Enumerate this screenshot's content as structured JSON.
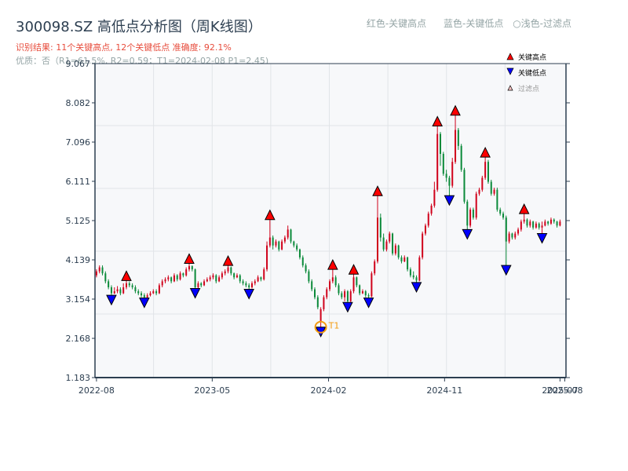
{
  "header": {
    "title": "300098.SZ 高低点分析图（周K线图）",
    "result": "识别结果: 11个关键高点, 12个关键低点  准确度: 92.1%",
    "quality": "优质：否（R1=61.5%, R2=0.59；T1=2024-02-08 P1=2.45)"
  },
  "top_legend": [
    "红色-关键高点",
    "蓝色-关键低点",
    "○浅色-过滤点"
  ],
  "colors": {
    "up": "#d0021b",
    "down": "#0b8a3a",
    "high_marker": "#ff0000",
    "low_marker": "#0000ff",
    "t1": "#f39c12",
    "axis": "#2c3e50",
    "grid": "#e1e4e8",
    "plot_bg": "#f7f8fa"
  },
  "chart_data": {
    "type": "candlestick",
    "ylim": [
      1.183,
      9.067
    ],
    "yticks": [
      "1.183",
      "2.168",
      "3.154",
      "4.139",
      "5.125",
      "6.111",
      "7.096",
      "8.082",
      "9.067"
    ],
    "xticks": [
      {
        "label": "2022-08",
        "index": 0
      },
      {
        "label": "2023-05",
        "index": 38.7
      },
      {
        "label": "2024-02",
        "index": 77.6
      },
      {
        "label": "2024-11",
        "index": 116.4
      },
      {
        "label": "2025-07",
        "index": 155
      },
      {
        "label": "2025-08",
        "index": 156.6
      }
    ],
    "grid": true,
    "legend": {
      "placement": "top-right",
      "entries": [
        "关键高点",
        "关键低点",
        "过滤点"
      ]
    },
    "candles_ohlc": [
      [
        3.75,
        3.9,
        3.7,
        3.85
      ],
      [
        3.85,
        4.0,
        3.8,
        3.95
      ],
      [
        3.95,
        4.0,
        3.75,
        3.8
      ],
      [
        3.8,
        3.85,
        3.55,
        3.6
      ],
      [
        3.6,
        3.65,
        3.4,
        3.45
      ],
      [
        3.45,
        3.5,
        3.25,
        3.3
      ],
      [
        3.3,
        3.45,
        3.28,
        3.35
      ],
      [
        3.35,
        3.48,
        3.3,
        3.4
      ],
      [
        3.4,
        3.45,
        3.25,
        3.3
      ],
      [
        3.3,
        3.55,
        3.28,
        3.45
      ],
      [
        3.45,
        3.62,
        3.4,
        3.55
      ],
      [
        3.55,
        3.6,
        3.45,
        3.5
      ],
      [
        3.5,
        3.55,
        3.4,
        3.45
      ],
      [
        3.45,
        3.5,
        3.3,
        3.35
      ],
      [
        3.35,
        3.4,
        3.25,
        3.3
      ],
      [
        3.3,
        3.35,
        3.2,
        3.25
      ],
      [
        3.25,
        3.3,
        3.18,
        3.2
      ],
      [
        3.2,
        3.3,
        3.18,
        3.25
      ],
      [
        3.25,
        3.35,
        3.22,
        3.3
      ],
      [
        3.3,
        3.4,
        3.28,
        3.35
      ],
      [
        3.35,
        3.4,
        3.25,
        3.3
      ],
      [
        3.3,
        3.55,
        3.28,
        3.5
      ],
      [
        3.5,
        3.65,
        3.45,
        3.6
      ],
      [
        3.6,
        3.7,
        3.55,
        3.65
      ],
      [
        3.65,
        3.75,
        3.6,
        3.7
      ],
      [
        3.7,
        3.72,
        3.55,
        3.6
      ],
      [
        3.6,
        3.8,
        3.58,
        3.75
      ],
      [
        3.75,
        3.78,
        3.6,
        3.65
      ],
      [
        3.65,
        3.85,
        3.62,
        3.8
      ],
      [
        3.8,
        3.82,
        3.7,
        3.75
      ],
      [
        3.75,
        3.95,
        3.72,
        3.9
      ],
      [
        3.9,
        4.05,
        3.85,
        3.98
      ],
      [
        3.98,
        4.0,
        3.85,
        3.9
      ],
      [
        3.9,
        3.92,
        3.42,
        3.45
      ],
      [
        3.45,
        3.6,
        3.42,
        3.55
      ],
      [
        3.55,
        3.58,
        3.45,
        3.5
      ],
      [
        3.5,
        3.65,
        3.48,
        3.6
      ],
      [
        3.6,
        3.7,
        3.58,
        3.65
      ],
      [
        3.65,
        3.75,
        3.6,
        3.7
      ],
      [
        3.7,
        3.8,
        3.65,
        3.75
      ],
      [
        3.75,
        3.78,
        3.55,
        3.6
      ],
      [
        3.6,
        3.75,
        3.58,
        3.7
      ],
      [
        3.7,
        3.85,
        3.65,
        3.8
      ],
      [
        3.8,
        3.9,
        3.75,
        3.85
      ],
      [
        3.85,
        4.0,
        3.8,
        3.95
      ],
      [
        3.95,
        3.97,
        3.75,
        3.8
      ],
      [
        3.8,
        3.82,
        3.65,
        3.7
      ],
      [
        3.7,
        3.8,
        3.68,
        3.75
      ],
      [
        3.75,
        3.78,
        3.55,
        3.6
      ],
      [
        3.6,
        3.65,
        3.5,
        3.55
      ],
      [
        3.55,
        3.6,
        3.45,
        3.5
      ],
      [
        3.5,
        3.55,
        3.4,
        3.45
      ],
      [
        3.45,
        3.6,
        3.42,
        3.55
      ],
      [
        3.55,
        3.65,
        3.5,
        3.6
      ],
      [
        3.6,
        3.75,
        3.58,
        3.7
      ],
      [
        3.7,
        3.72,
        3.6,
        3.65
      ],
      [
        3.65,
        3.95,
        3.62,
        3.9
      ],
      [
        3.9,
        4.6,
        3.85,
        4.5
      ],
      [
        4.5,
        5.15,
        4.45,
        4.7
      ],
      [
        4.7,
        4.75,
        4.4,
        4.5
      ],
      [
        4.5,
        4.65,
        4.45,
        4.6
      ],
      [
        4.6,
        4.62,
        4.35,
        4.4
      ],
      [
        4.4,
        4.65,
        4.38,
        4.6
      ],
      [
        4.6,
        4.75,
        4.55,
        4.7
      ],
      [
        4.7,
        5.0,
        4.65,
        4.9
      ],
      [
        4.9,
        4.92,
        4.55,
        4.6
      ],
      [
        4.6,
        4.62,
        4.45,
        4.5
      ],
      [
        4.5,
        4.55,
        4.35,
        4.4
      ],
      [
        4.4,
        4.42,
        4.15,
        4.2
      ],
      [
        4.2,
        4.25,
        3.95,
        4.0
      ],
      [
        4.0,
        4.05,
        3.8,
        3.85
      ],
      [
        3.85,
        3.9,
        3.55,
        3.6
      ],
      [
        3.6,
        3.65,
        3.35,
        3.4
      ],
      [
        3.4,
        3.45,
        3.15,
        3.2
      ],
      [
        3.2,
        3.25,
        2.9,
        2.95
      ],
      [
        2.6,
        2.95,
        2.45,
        2.9
      ],
      [
        2.9,
        3.25,
        2.85,
        3.2
      ],
      [
        3.2,
        3.45,
        3.15,
        3.4
      ],
      [
        3.4,
        3.65,
        3.35,
        3.6
      ],
      [
        3.6,
        3.9,
        3.55,
        3.7
      ],
      [
        3.7,
        3.75,
        3.45,
        3.5
      ],
      [
        3.5,
        3.55,
        3.25,
        3.3
      ],
      [
        3.3,
        3.35,
        3.15,
        3.2
      ],
      [
        3.2,
        3.4,
        3.1,
        3.35
      ],
      [
        3.35,
        3.38,
        3.07,
        3.1
      ],
      [
        3.1,
        3.4,
        3.08,
        3.35
      ],
      [
        3.35,
        3.78,
        3.3,
        3.7
      ],
      [
        3.7,
        3.72,
        3.45,
        3.5
      ],
      [
        3.5,
        3.52,
        3.25,
        3.3
      ],
      [
        3.3,
        3.4,
        3.28,
        3.35
      ],
      [
        3.35,
        3.38,
        3.2,
        3.25
      ],
      [
        3.25,
        3.3,
        3.18,
        3.22
      ],
      [
        3.22,
        3.85,
        3.2,
        3.8
      ],
      [
        3.8,
        4.15,
        3.75,
        4.1
      ],
      [
        4.1,
        5.75,
        4.05,
        5.2
      ],
      [
        5.2,
        5.3,
        4.6,
        4.7
      ],
      [
        4.7,
        4.8,
        4.35,
        4.4
      ],
      [
        4.4,
        4.65,
        4.35,
        4.6
      ],
      [
        4.6,
        4.85,
        4.55,
        4.8
      ],
      [
        4.8,
        4.82,
        4.25,
        4.3
      ],
      [
        4.3,
        4.55,
        4.25,
        4.5
      ],
      [
        4.5,
        4.52,
        4.15,
        4.2
      ],
      [
        4.2,
        4.25,
        4.05,
        4.1
      ],
      [
        4.1,
        4.25,
        4.08,
        4.2
      ],
      [
        4.2,
        4.22,
        3.85,
        3.9
      ],
      [
        3.9,
        3.95,
        3.7,
        3.75
      ],
      [
        3.75,
        3.85,
        3.65,
        3.7
      ],
      [
        3.7,
        3.75,
        3.57,
        3.62
      ],
      [
        3.62,
        4.25,
        3.6,
        4.2
      ],
      [
        4.2,
        4.85,
        4.15,
        4.8
      ],
      [
        4.8,
        5.05,
        4.75,
        5.0
      ],
      [
        5.0,
        5.35,
        4.95,
        5.3
      ],
      [
        5.3,
        5.55,
        5.25,
        5.5
      ],
      [
        5.5,
        6.1,
        5.45,
        5.9
      ],
      [
        5.9,
        7.5,
        5.85,
        7.3
      ],
      [
        7.3,
        7.35,
        6.5,
        6.8
      ],
      [
        6.8,
        6.85,
        6.25,
        6.3
      ],
      [
        6.3,
        6.4,
        6.1,
        6.2
      ],
      [
        6.2,
        6.25,
        5.75,
        6.0
      ],
      [
        6.0,
        6.7,
        5.95,
        6.6
      ],
      [
        6.6,
        7.77,
        6.55,
        7.4
      ],
      [
        7.4,
        7.45,
        6.9,
        7.0
      ],
      [
        7.0,
        7.05,
        6.35,
        6.4
      ],
      [
        6.4,
        6.45,
        5.55,
        5.6
      ],
      [
        5.6,
        5.65,
        4.9,
        5.0
      ],
      [
        5.0,
        5.45,
        4.95,
        5.4
      ],
      [
        5.4,
        5.45,
        5.15,
        5.2
      ],
      [
        5.2,
        5.85,
        5.15,
        5.8
      ],
      [
        5.8,
        5.95,
        5.75,
        5.9
      ],
      [
        5.9,
        6.25,
        5.85,
        6.2
      ],
      [
        6.2,
        6.72,
        6.15,
        6.6
      ],
      [
        6.6,
        6.65,
        6.05,
        6.1
      ],
      [
        6.1,
        6.15,
        5.75,
        5.8
      ],
      [
        5.8,
        5.95,
        5.75,
        5.9
      ],
      [
        5.9,
        5.95,
        5.35,
        5.4
      ],
      [
        5.4,
        5.45,
        5.25,
        5.3
      ],
      [
        5.3,
        5.35,
        5.15,
        5.2
      ],
      [
        5.2,
        5.25,
        4.0,
        4.6
      ],
      [
        4.6,
        4.85,
        4.55,
        4.8
      ],
      [
        4.8,
        4.82,
        4.65,
        4.7
      ],
      [
        4.7,
        4.85,
        4.65,
        4.8
      ],
      [
        4.8,
        4.95,
        4.75,
        4.9
      ],
      [
        4.9,
        5.15,
        4.85,
        5.1
      ],
      [
        5.1,
        5.3,
        5.05,
        5.15
      ],
      [
        5.15,
        5.18,
        4.95,
        5.0
      ],
      [
        5.0,
        5.15,
        4.95,
        5.1
      ],
      [
        5.1,
        5.12,
        4.9,
        4.95
      ],
      [
        4.95,
        5.1,
        4.92,
        5.05
      ],
      [
        5.05,
        5.08,
        4.9,
        4.95
      ],
      [
        4.95,
        5.1,
        4.8,
        5.0
      ],
      [
        5.0,
        5.15,
        4.98,
        5.1
      ],
      [
        5.1,
        5.12,
        5.0,
        5.05
      ],
      [
        5.05,
        5.2,
        5.02,
        5.15
      ],
      [
        5.15,
        5.18,
        5.05,
        5.1
      ],
      [
        5.1,
        5.12,
        4.95,
        5.0
      ],
      [
        5.0,
        5.15,
        4.98,
        5.1
      ]
    ],
    "key_highs": [
      10,
      31,
      44,
      58,
      79,
      86,
      94,
      114,
      120,
      130,
      143
    ],
    "key_lows": [
      5,
      16,
      33,
      51,
      75,
      84,
      91,
      107,
      118,
      124,
      137,
      149
    ],
    "t1": {
      "label": "T1",
      "index": 75,
      "price": 2.45
    }
  }
}
